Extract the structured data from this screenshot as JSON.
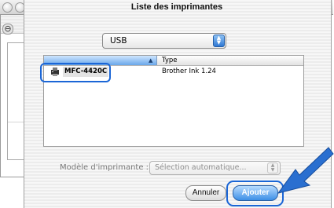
{
  "window": {
    "title": "Liste des imprimantes"
  },
  "connection_popup": {
    "selected": "USB"
  },
  "printer_table": {
    "columns": [
      "",
      "Type"
    ],
    "rows": [
      {
        "name": "MFC-4420C",
        "type": "Brother Ink 1.24"
      }
    ]
  },
  "model": {
    "label": "Modèle d'imprimante :",
    "selected": "Sélection automatique..."
  },
  "buttons": {
    "cancel": "Annuler",
    "add": "Ajouter"
  },
  "background_window": {
    "minus_glyph": "⊖"
  },
  "colors": {
    "accent_blue": "#1b66d6",
    "pointer_blue": "#2a6fd0"
  },
  "icons": [
    "printer-icon",
    "popup-arrows-icon",
    "pointer-arrow-icon"
  ]
}
